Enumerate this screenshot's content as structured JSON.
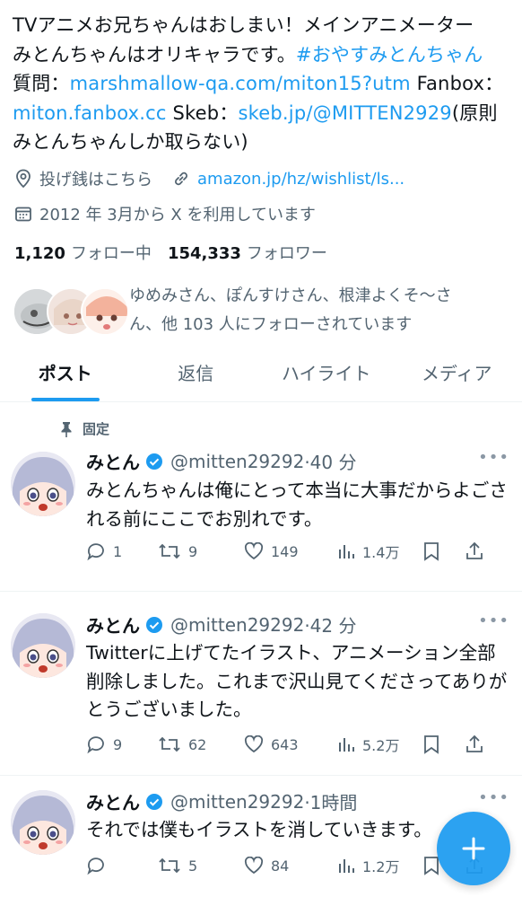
{
  "bio": {
    "line1": "TVアニメお兄ちゃんはおしまい！メインアニメーター",
    "line2_text": "みとんちゃんはオリキャラです。",
    "line2_tag": "#おやすみとんちゃん",
    "line3_label": "質問：",
    "line3_link": "marshmallow-qa.com/miton15?utm",
    "line3_fanbox": " Fanbox：",
    "line4_link1": "miton.fanbox.cc",
    "line4_skeb": " Skeb：",
    "line4_link2": "skeb.jp/@MITTEN2929",
    "line4_tail": "(原則",
    "line5": "みとんちゃんしか取らない)"
  },
  "meta": {
    "location": "投げ銭はこちら",
    "website": "amazon.jp/hz/wishlist/ls...",
    "joined": "2012 年 3月から X を利用しています"
  },
  "follow": {
    "following_count": "1,120",
    "following_label": "フォロー中",
    "followers_count": "154,333",
    "followers_label": "フォロワー"
  },
  "known_followers": {
    "line1": "ゆめみさん、ぽんすけさん、根津よくそ〜さ",
    "line2": "ん、他 103 人にフォローされています"
  },
  "tabs": [
    "ポスト",
    "返信",
    "ハイライト",
    "メディア"
  ],
  "pinned_label": "固定",
  "tweets": [
    {
      "name": "みとん",
      "handle": "@mitten29292",
      "time": "·40 分",
      "body": "みとんちゃんは俺にとって本当に大事だからよごされる前にここでお別れです。",
      "replies": "1",
      "reposts": "9",
      "likes": "149",
      "views": "1.4万"
    },
    {
      "name": "みとん",
      "handle": "@mitten29292",
      "time": "·42 分",
      "body": "Twitterに上げてたイラスト、アニメーション全部削除しました。これまで沢山見てくださってありがとうございました。",
      "replies": "9",
      "reposts": "62",
      "likes": "643",
      "views": "5.2万"
    },
    {
      "name": "みとん",
      "handle": "@mitten29292",
      "time": "·1時間",
      "body": "それでは僕もイラストを消していきます。",
      "replies": "",
      "reposts": "5",
      "likes": "84",
      "views": "1.2万"
    }
  ],
  "colors": {
    "accent": "#1d9bf0",
    "secondary_text": "#536471",
    "primary_text": "#0f1419"
  }
}
